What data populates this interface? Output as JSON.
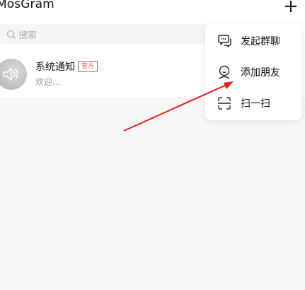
{
  "header": {
    "title": "MosGram"
  },
  "search": {
    "placeholder": "搜索"
  },
  "conversations": [
    {
      "name": "系统通知",
      "badge": "官方",
      "preview": "欢迎..."
    }
  ],
  "popup_menu": {
    "items": [
      {
        "label": "发起群聊",
        "icon": "group-chat-icon"
      },
      {
        "label": "添加朋友",
        "icon": "add-friend-icon"
      },
      {
        "label": "扫一扫",
        "icon": "scan-icon"
      }
    ]
  },
  "colors": {
    "annotation_arrow": "#e81d1d",
    "badge": "#e0564f",
    "background": "#f7f7f7"
  }
}
